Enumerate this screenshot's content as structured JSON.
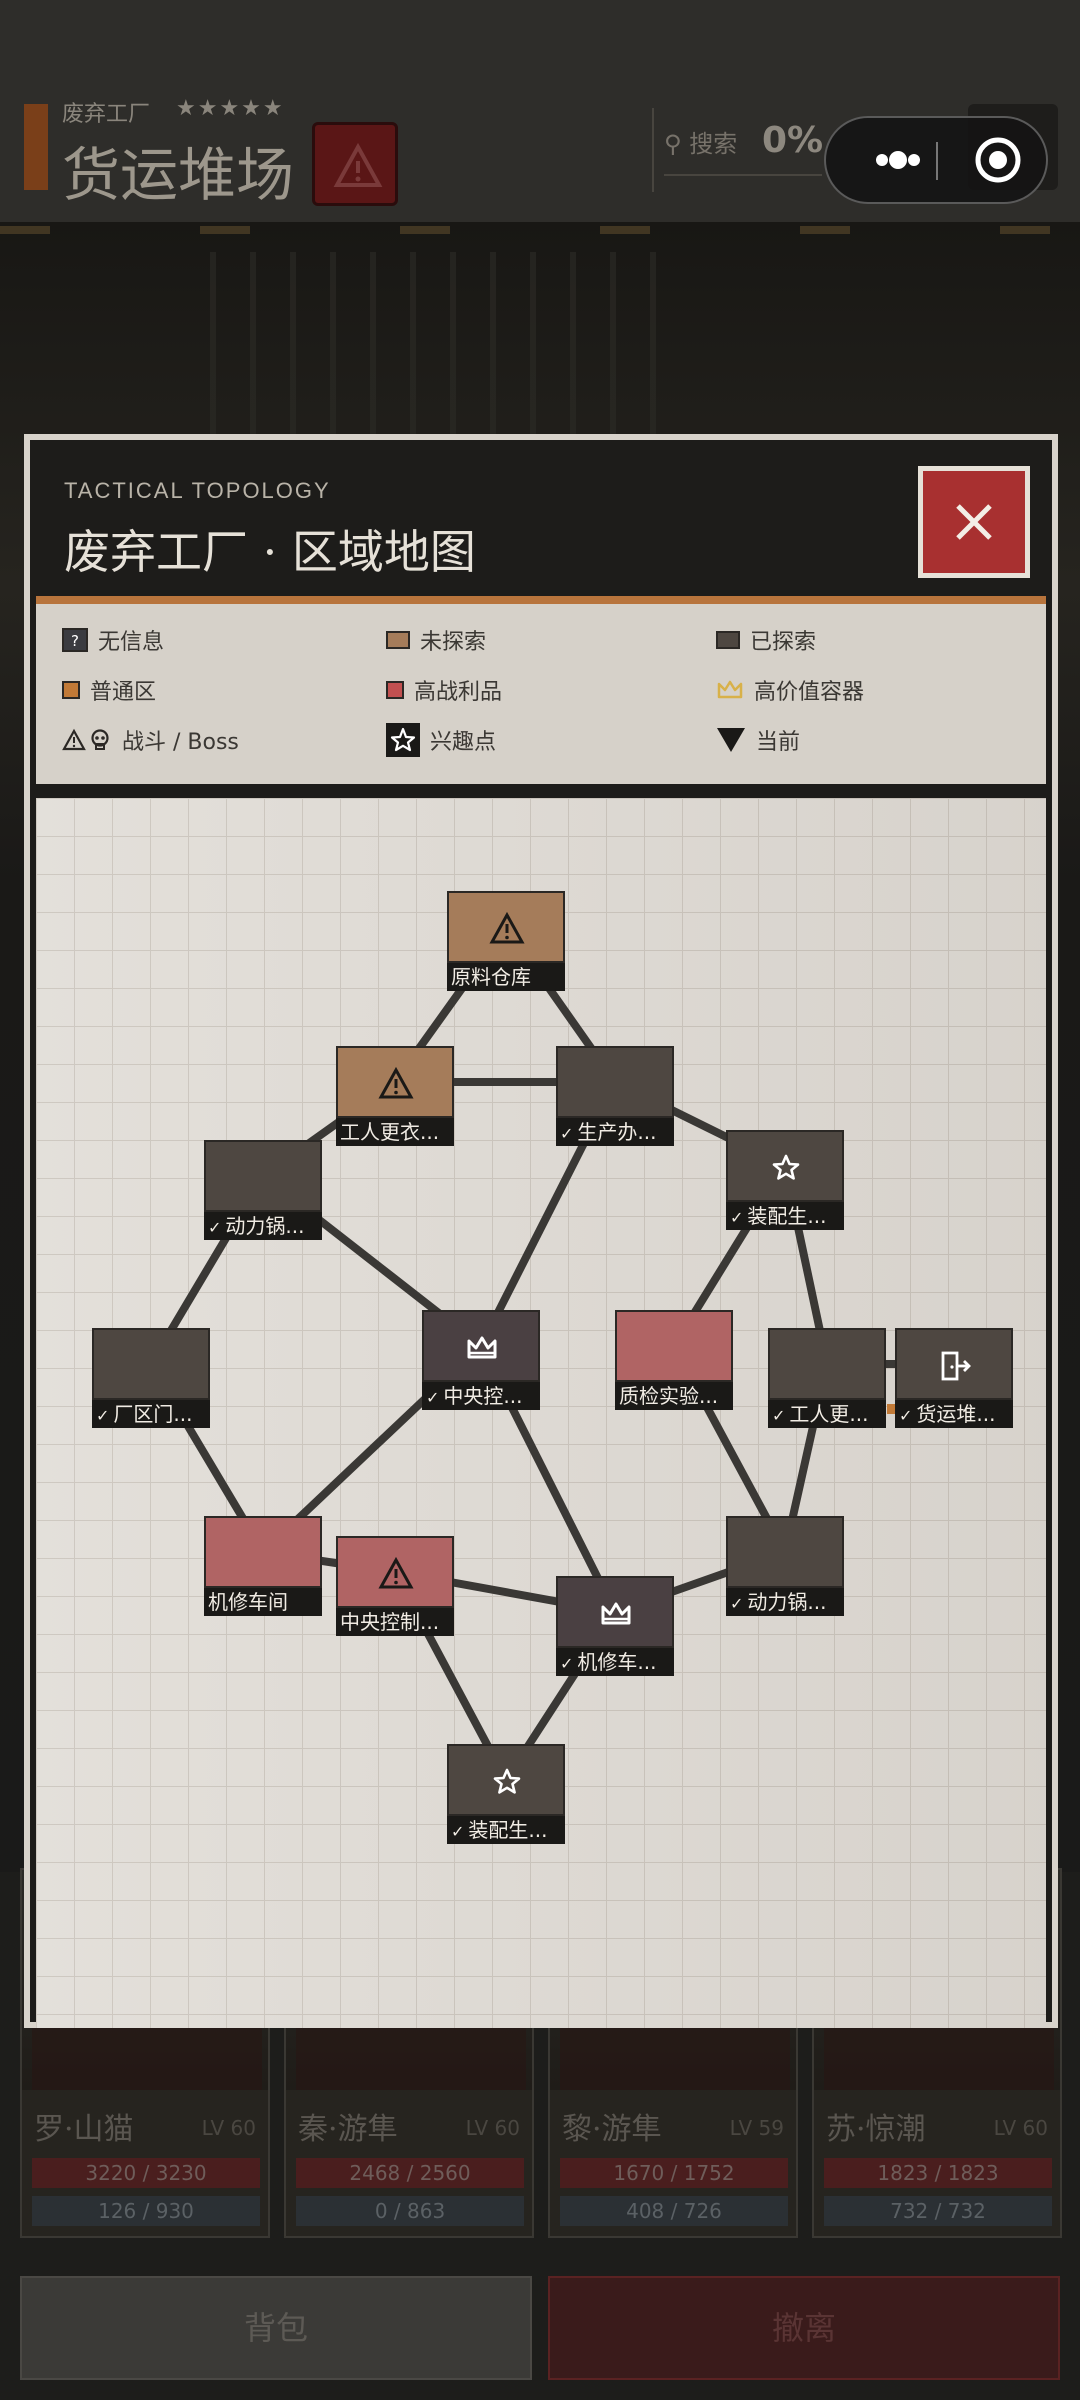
{
  "colors": {
    "unexplored": "#a57c5a",
    "explored": "#4e4741",
    "highloot": "#b06464",
    "boss_dark": "#4a4042",
    "normal_sw": "#c27a37",
    "gold": "#d8b149",
    "edge": "#3a3835",
    "close_red": "#a83030"
  },
  "background": {
    "location_label": "废弃工厂",
    "stars": "★★★★★",
    "title": "货运堆场",
    "search_label": "搜索",
    "explore_percent": "0%",
    "map_button_label": "地图",
    "team": [
      {
        "name": "罗·山猫",
        "level": "LV 60",
        "hp": "3220 / 3230",
        "mp": "126 / 930"
      },
      {
        "name": "秦·游隼",
        "level": "LV 60",
        "hp": "2468 / 2560",
        "mp": "0 / 863"
      },
      {
        "name": "黎·游隼",
        "level": "LV 59",
        "hp": "1670 / 1752",
        "mp": "408 / 726"
      },
      {
        "name": "苏·惊潮",
        "level": "LV 60",
        "hp": "1823 / 1823",
        "mp": "732 / 732"
      }
    ],
    "bag_button": "背包",
    "retreat_button": "撤离"
  },
  "modal": {
    "subtitle": "TACTICAL TOPOLOGY",
    "title": "废弃工厂 · 区域地图",
    "close_label": "×"
  },
  "legend": [
    {
      "key": "no-info",
      "label": "无信息",
      "icon": "question-icon"
    },
    {
      "key": "unexplored",
      "label": "未探索",
      "icon": "swatch"
    },
    {
      "key": "explored",
      "label": "已探索",
      "icon": "swatch"
    },
    {
      "key": "normal",
      "label": "普通区",
      "icon": "swatch"
    },
    {
      "key": "highloot",
      "label": "高战利品",
      "icon": "swatch"
    },
    {
      "key": "container",
      "label": "高价值容器",
      "icon": "crown-icon"
    },
    {
      "key": "combat",
      "label": "战斗 / Boss",
      "icon": "warning-skull-icon"
    },
    {
      "key": "poi",
      "label": "兴趣点",
      "icon": "star-icon"
    },
    {
      "key": "current",
      "label": "当前",
      "icon": "triangle-down-icon"
    }
  ],
  "map": {
    "nodes": [
      {
        "id": "n0",
        "label": "原料仓库",
        "fill": "unexplored",
        "icon": "warning",
        "visited": false
      },
      {
        "id": "n1",
        "label": "工人更衣...",
        "fill": "unexplored",
        "icon": "warning",
        "visited": false
      },
      {
        "id": "n2",
        "label": "生产办...",
        "fill": "explored",
        "icon": "",
        "visited": true
      },
      {
        "id": "n3",
        "label": "动力锅...",
        "fill": "explored",
        "icon": "",
        "visited": true
      },
      {
        "id": "n4",
        "label": "装配生...",
        "fill": "explored",
        "icon": "star",
        "visited": true
      },
      {
        "id": "n5",
        "label": "厂区门...",
        "fill": "explored",
        "icon": "",
        "visited": true
      },
      {
        "id": "n6",
        "label": "中央控...",
        "fill": "boss_dark",
        "icon": "crown",
        "visited": true
      },
      {
        "id": "n7",
        "label": "质检实验...",
        "fill": "highloot",
        "icon": "",
        "visited": false
      },
      {
        "id": "n8",
        "label": "工人更...",
        "fill": "explored",
        "icon": "",
        "visited": true
      },
      {
        "id": "n9",
        "label": "货运堆...",
        "fill": "explored",
        "icon": "exit",
        "visited": true,
        "current": true
      },
      {
        "id": "n10",
        "label": "机修车间",
        "fill": "highloot",
        "icon": "",
        "visited": false
      },
      {
        "id": "n11",
        "label": "中央控制...",
        "fill": "highloot",
        "icon": "warning",
        "visited": false
      },
      {
        "id": "n12",
        "label": "机修车...",
        "fill": "boss_dark",
        "icon": "crown",
        "visited": true
      },
      {
        "id": "n13",
        "label": "动力锅...",
        "fill": "explored",
        "icon": "",
        "visited": true
      },
      {
        "id": "n14",
        "label": "装配生...",
        "fill": "explored",
        "icon": "star",
        "visited": true
      }
    ],
    "edges": [
      [
        "n0",
        "n1"
      ],
      [
        "n0",
        "n2"
      ],
      [
        "n1",
        "n2"
      ],
      [
        "n1",
        "n3"
      ],
      [
        "n2",
        "n4"
      ],
      [
        "n2",
        "n6"
      ],
      [
        "n3",
        "n5"
      ],
      [
        "n3",
        "n6"
      ],
      [
        "n4",
        "n7"
      ],
      [
        "n4",
        "n8"
      ],
      [
        "n5",
        "n10"
      ],
      [
        "n6",
        "n10"
      ],
      [
        "n6",
        "n12"
      ],
      [
        "n7",
        "n13"
      ],
      [
        "n8",
        "n13"
      ],
      [
        "n10",
        "n11"
      ],
      [
        "n11",
        "n12"
      ],
      [
        "n11",
        "n14"
      ],
      [
        "n12",
        "n13"
      ],
      [
        "n12",
        "n14"
      ],
      [
        "n8",
        "n9"
      ]
    ]
  }
}
